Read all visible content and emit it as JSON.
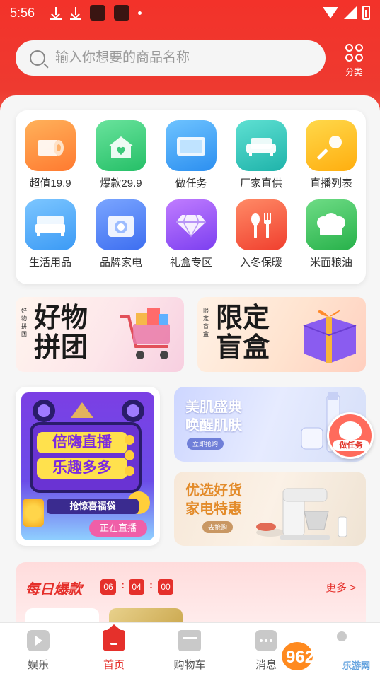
{
  "status_bar": {
    "time": "5:56"
  },
  "search": {
    "placeholder": "输入你想要的商品名称"
  },
  "category": {
    "label": "分类"
  },
  "grid": [
    {
      "label": "超值19.9",
      "icon": "tissue-roll-icon",
      "color": "#ff9640"
    },
    {
      "label": "爆款29.9",
      "icon": "house-heart-icon",
      "color": "#3ed07d"
    },
    {
      "label": "做任务",
      "icon": "tv-icon",
      "color": "#3fa3f5"
    },
    {
      "label": "厂家直供",
      "icon": "sofa-icon",
      "color": "#33c6bd"
    },
    {
      "label": "直播列表",
      "icon": "microphone-icon",
      "color": "#ffc21c"
    },
    {
      "label": "生活用品",
      "icon": "bed-icon",
      "color": "#49a6ff"
    },
    {
      "label": "品牌家电",
      "icon": "camera-icon",
      "color": "#4d86f7"
    },
    {
      "label": "礼盒专区",
      "icon": "diamond-icon",
      "color": "#9b59f5"
    },
    {
      "label": "入冬保暖",
      "icon": "utensils-icon",
      "color": "#ff5a45"
    },
    {
      "label": "米面粮油",
      "icon": "chef-hat-icon",
      "color": "#39c45f"
    }
  ],
  "banners": {
    "group_buy": {
      "tag": "好物拼团",
      "line1": "好物",
      "line2": "拼团"
    },
    "blind_box": {
      "tag": "限定盲盒",
      "line1": "限定",
      "line2": "盲盒"
    }
  },
  "live": {
    "title": "倍嗨直播",
    "subtitle": "乐趣多多",
    "ribbon": "抢惊喜福袋",
    "badge": "正在直播"
  },
  "promo_beauty": {
    "line1": "美肌盛典",
    "line2": "唤醒肌肤",
    "button": "立即抢购"
  },
  "promo_appliance": {
    "line1": "优选好货",
    "line2": "家电特惠",
    "button": "去抢购"
  },
  "task_badge": {
    "label": "做任务"
  },
  "daily": {
    "title": "每日爆款",
    "hours": "06",
    "minutes": "04",
    "seconds": "00",
    "sep": ":",
    "more": "更多 >"
  },
  "nav": [
    {
      "label": "娱乐",
      "icon": "play-icon",
      "active": false
    },
    {
      "label": "首页",
      "icon": "home-icon",
      "active": true
    },
    {
      "label": "购物车",
      "icon": "cart-icon",
      "active": false
    },
    {
      "label": "消息",
      "icon": "message-icon",
      "active": false
    }
  ],
  "watermark": {
    "brand": "962.NET",
    "sub": "乐游网"
  },
  "colors": {
    "brand_red": "#e5302b",
    "header_red": "#f3322a"
  }
}
